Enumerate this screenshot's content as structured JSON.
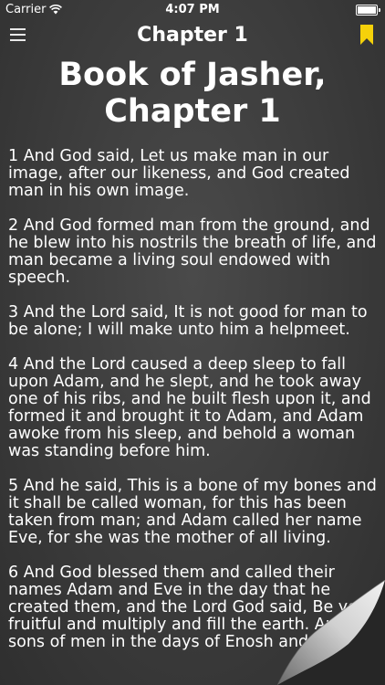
{
  "status_bar": {
    "carrier": "Carrier",
    "time": "4:07 PM"
  },
  "nav": {
    "title": "Chapter 1",
    "accent_color": "#f5d10a"
  },
  "heading": {
    "line1": "Book of Jasher,",
    "line2": "Chapter 1"
  },
  "verses": [
    "1 And God said, Let us make man in our image, after our likeness, and God created man in his own image.",
    "2 And God formed man from the ground, and he blew into his nostrils the breath of life, and man became a living soul endowed with speech.",
    "3 And the Lord said, It is not good for man to be alone; I will make unto him a helpmeet.",
    "4 And the Lord caused a deep sleep to fall upon Adam, and he slept, and he took away one of his ribs, and he built flesh upon it, and formed it and brought it to Adam, and Adam awoke from his sleep, and behold a woman was standing before him.",
    "5 And he said, This is a bone of my bones and it shall be called woman, for this has been taken from man; and Adam called her name Eve, for she was the mother of all living.",
    "6 And God blessed them and called their names Adam and Eve in the day that he created them, and the Lord God said, Be ye fruitful and multiply and fill the earth. And the sons of men in the days of Enosh and"
  ]
}
